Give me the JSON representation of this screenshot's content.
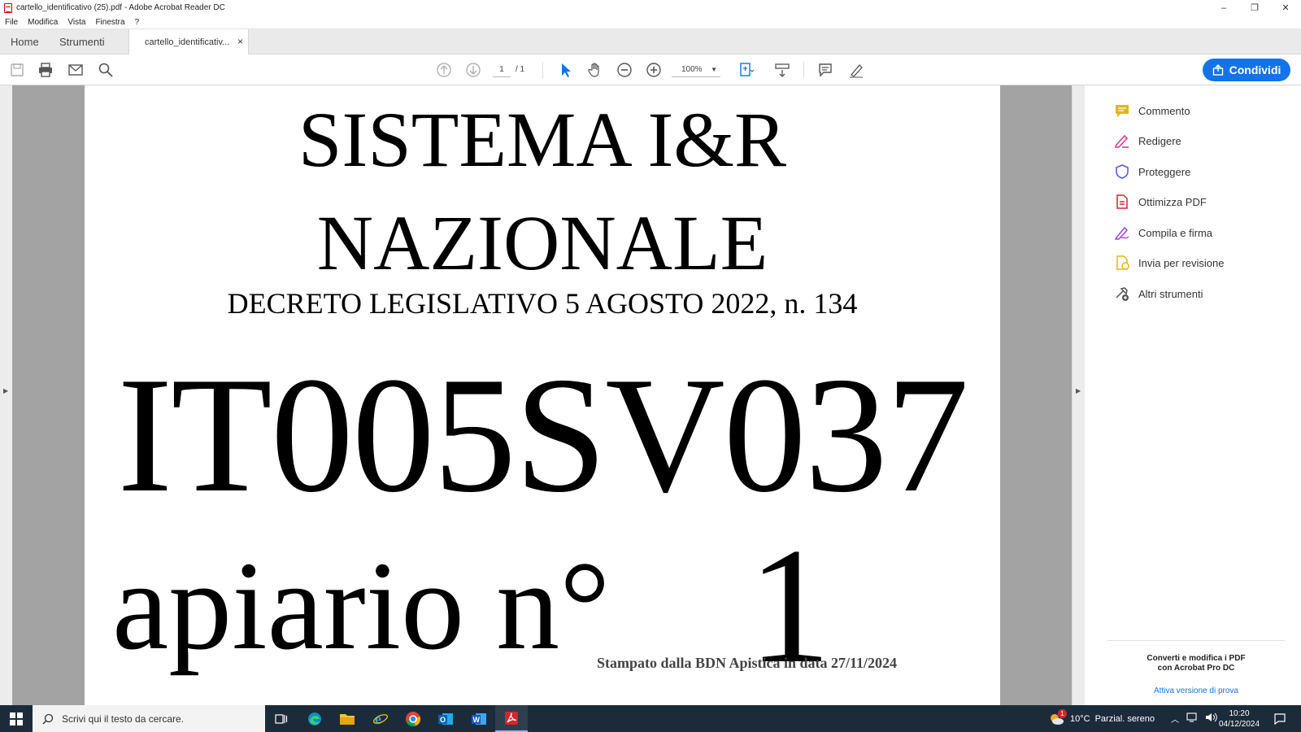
{
  "window": {
    "title": "cartello_identificativo (25).pdf - Adobe Acrobat Reader DC",
    "controls": {
      "minimize": "–",
      "restore": "❐",
      "close": "✕"
    }
  },
  "menu": [
    "File",
    "Modifica",
    "Vista",
    "Finestra",
    "?"
  ],
  "tabs": {
    "home": "Home",
    "tools": "Strumenti",
    "document": "cartello_identificativ...",
    "close": "×"
  },
  "toolbar": {
    "page_current": "1",
    "page_total": "/ 1",
    "zoom": "100%",
    "share_label": "Condividi"
  },
  "page": {
    "line1": "SISTEMA I&R",
    "line2": "NAZIONALE",
    "line3": "DECRETO LEGISLATIVO 5 AGOSTO 2022, n. 134",
    "code": "IT005SV037",
    "apiario_label": "apiario n°",
    "apiario_number": "1",
    "footer": "Stampato dalla BDN Apistica in data 27/11/2024"
  },
  "right_panel": {
    "items": [
      {
        "label": "Commento",
        "icon": "comment-icon",
        "color": "#e8b512"
      },
      {
        "label": "Redigere",
        "icon": "redact-icon",
        "color": "#e0388c"
      },
      {
        "label": "Proteggere",
        "icon": "shield-icon",
        "color": "#5b5bd6"
      },
      {
        "label": "Ottimizza PDF",
        "icon": "optimize-pdf-icon",
        "color": "#d6252d"
      },
      {
        "label": "Compila e firma",
        "icon": "fill-sign-icon",
        "color": "#9b44d4"
      },
      {
        "label": "Invia per revisione",
        "icon": "send-review-icon",
        "color": "#e8b512"
      },
      {
        "label": "Altri strumenti",
        "icon": "more-tools-icon",
        "color": "#555555"
      }
    ],
    "promo_line1": "Converti e modifica i PDF",
    "promo_line2": "con Acrobat Pro DC",
    "promo_link": "Attiva versione di prova"
  },
  "taskbar": {
    "search_placeholder": "Scrivi qui il testo da cercare.",
    "weather_temp": "10°C",
    "weather_desc": "Parzial. sereno",
    "time": "10:20",
    "date": "04/12/2024",
    "weather_badge": "1"
  },
  "colors": {
    "accent": "#1473e6",
    "taskbar": "#1c2b3a"
  }
}
